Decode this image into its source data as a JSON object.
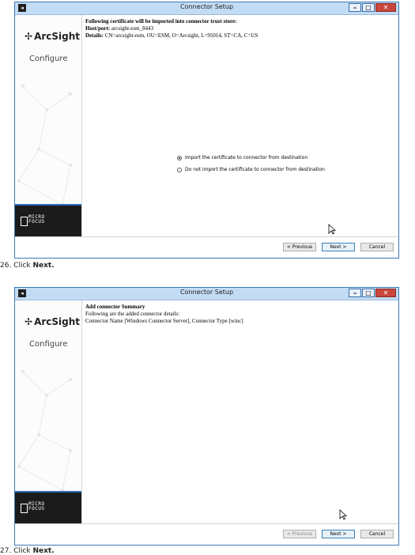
{
  "window1": {
    "title": "Connector Setup",
    "sidebar": {
      "brand": "ArcSight",
      "section": "Configure",
      "footer_brand": "MICRO\nFOCUS"
    },
    "heading": "Following certificate will be imported into connector trust store:",
    "host_label": "Host/port:",
    "host_value": " arcsight-esm_8443",
    "details_label": "Details:",
    "details_value": " CN=arcsight-esm, OU=ESM, O=Arcsight, L=95014, ST=CA, C=US",
    "radio_import": "Import the certificate to connector from destination",
    "radio_no_import": "Do not import the certificate to connector from destination",
    "btn_previous": "< Previous",
    "btn_next": "Next >",
    "btn_cancel": "Cancel"
  },
  "step26": {
    "number": "26. Click ",
    "action": "Next."
  },
  "window2": {
    "title": "Connector Setup",
    "sidebar": {
      "brand": "ArcSight",
      "section": "Configure",
      "footer_brand": "MICRO\nFOCUS"
    },
    "heading": "Add connector Summary",
    "line1": "Following are the added connector details:",
    "line2": "Connector Name [Windows Connector Server], Connector Type [winc]",
    "btn_previous": "< Previous",
    "btn_next": "Next >",
    "btn_cancel": "Cancel"
  },
  "step27": {
    "number": "27. Click ",
    "action": "Next."
  },
  "icons": {
    "system": "system-menu-icon",
    "minimize": "minimize-icon",
    "maximize": "maximize-icon",
    "close": "close-icon",
    "cursor": "mouse-cursor-icon"
  }
}
